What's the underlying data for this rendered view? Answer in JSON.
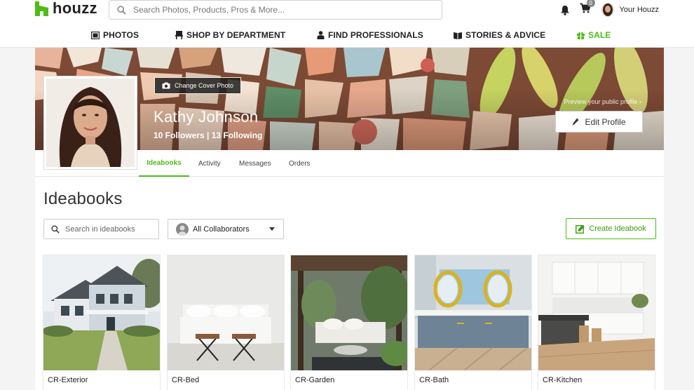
{
  "header": {
    "logo_text": "houzz",
    "search_placeholder": "Search Photos, Products, Pros & More...",
    "cart_count": "0",
    "user_label": "Your Houzz"
  },
  "nav": [
    {
      "label": "PHOTOS",
      "icon": "photos-icon"
    },
    {
      "label": "SHOP BY DEPARTMENT",
      "icon": "chair-icon"
    },
    {
      "label": "FIND PROFESSIONALS",
      "icon": "person-icon"
    },
    {
      "label": "STORIES & ADVICE",
      "icon": "book-icon"
    },
    {
      "label": "SALE",
      "icon": "gift-icon"
    }
  ],
  "profile": {
    "change_cover_label": "Change Cover Photo",
    "name": "Kathy Johnson",
    "followers_line": "10 Followers | 13 Following",
    "preview_link": "Preview your public profile ›",
    "edit_label": "Edit Profile"
  },
  "tabs": [
    {
      "label": "Ideabooks",
      "active": true
    },
    {
      "label": "Activity",
      "active": false
    },
    {
      "label": "Messages",
      "active": false
    },
    {
      "label": "Orders",
      "active": false
    }
  ],
  "ideabooks": {
    "title": "Ideabooks",
    "search_placeholder": "Search in ideabooks",
    "collaborators_label": "All Collaborators",
    "create_label": "Create Ideabook",
    "items": [
      {
        "title": "CR-Exterior"
      },
      {
        "title": "CR-Bed"
      },
      {
        "title": "CR-Garden"
      },
      {
        "title": "CR-Bath"
      },
      {
        "title": "CR-Kitchen"
      }
    ]
  },
  "colors": {
    "accent_green": "#4dbc15",
    "text_dark": "#222222"
  }
}
